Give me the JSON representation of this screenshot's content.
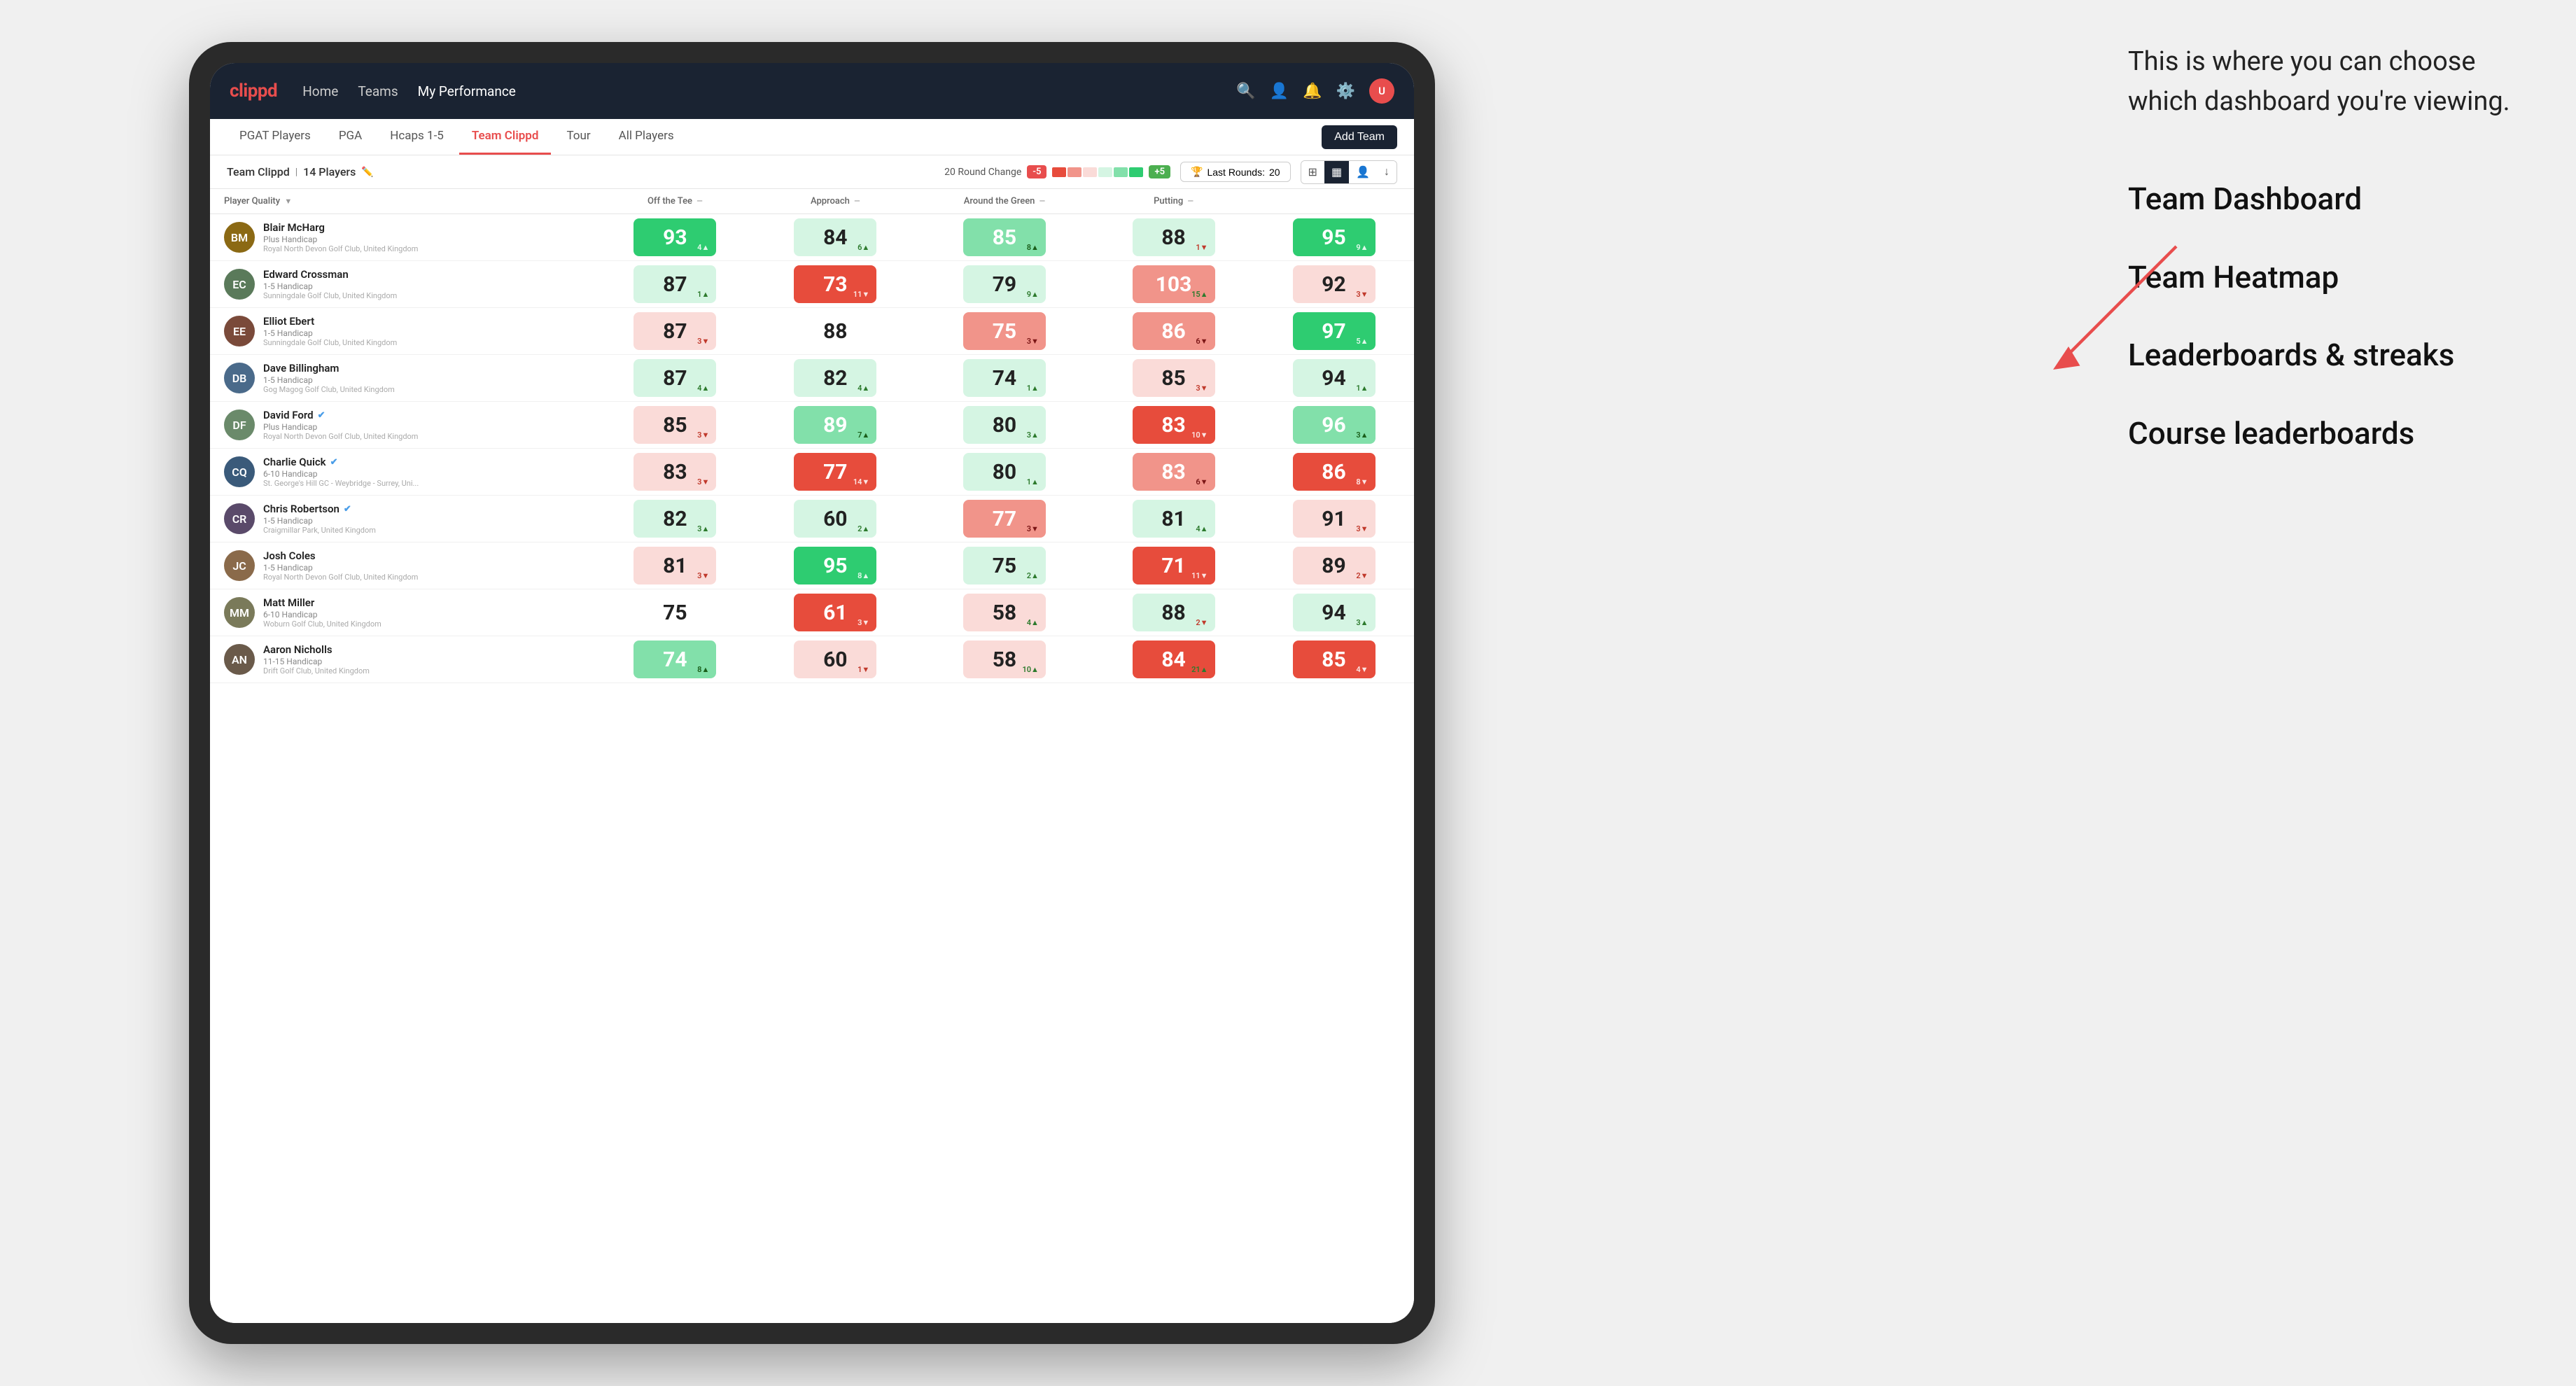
{
  "annotation": {
    "intro": "This is where you can choose which dashboard you're viewing.",
    "items": [
      "Team Dashboard",
      "Team Heatmap",
      "Leaderboards & streaks",
      "Course leaderboards"
    ]
  },
  "navbar": {
    "logo": "clippd",
    "links": [
      {
        "label": "Home",
        "active": false
      },
      {
        "label": "Teams",
        "active": false
      },
      {
        "label": "My Performance",
        "active": true
      }
    ],
    "icons": [
      "search",
      "person",
      "bell",
      "settings",
      "avatar"
    ]
  },
  "sub_nav": {
    "tabs": [
      {
        "label": "PGAT Players",
        "active": false
      },
      {
        "label": "PGA",
        "active": false
      },
      {
        "label": "Hcaps 1-5",
        "active": false
      },
      {
        "label": "Team Clippd",
        "active": true
      },
      {
        "label": "Tour",
        "active": false
      },
      {
        "label": "All Players",
        "active": false
      }
    ],
    "add_team_label": "Add Team"
  },
  "team_header": {
    "title": "Team Clippd",
    "count": "14 Players",
    "round_change_label": "20 Round Change",
    "round_neg": "-5",
    "round_pos": "+5",
    "last_rounds_label": "Last Rounds:",
    "last_rounds_value": "20"
  },
  "table": {
    "columns": [
      {
        "label": "Player Quality",
        "sort": "▼",
        "key": "player_quality"
      },
      {
        "label": "Off the Tee",
        "sort": "—",
        "key": "off_tee"
      },
      {
        "label": "Approach",
        "sort": "—",
        "key": "approach"
      },
      {
        "label": "Around the Green",
        "sort": "—",
        "key": "around_green"
      },
      {
        "label": "Putting",
        "sort": "—",
        "key": "putting"
      }
    ],
    "rows": [
      {
        "name": "Blair McHarg",
        "handicap": "Plus Handicap",
        "club": "Royal North Devon Golf Club, United Kingdom",
        "initials": "BM",
        "avatar_color": "#8B6914",
        "scores": [
          {
            "value": "93",
            "change": "4▲",
            "direction": "up",
            "bg": "bg-green-strong"
          },
          {
            "value": "84",
            "change": "6▲",
            "direction": "up",
            "bg": "bg-green-light"
          },
          {
            "value": "85",
            "change": "8▲",
            "direction": "up",
            "bg": "bg-green-med"
          },
          {
            "value": "88",
            "change": "1▼",
            "direction": "down",
            "bg": "bg-green-light"
          },
          {
            "value": "95",
            "change": "9▲",
            "direction": "up",
            "bg": "bg-green-strong"
          }
        ]
      },
      {
        "name": "Edward Crossman",
        "handicap": "1-5 Handicap",
        "club": "Sunningdale Golf Club, United Kingdom",
        "initials": "EC",
        "avatar_color": "#5a7a5a",
        "scores": [
          {
            "value": "87",
            "change": "1▲",
            "direction": "up",
            "bg": "bg-green-light"
          },
          {
            "value": "73",
            "change": "11▼",
            "direction": "down",
            "bg": "bg-red-strong"
          },
          {
            "value": "79",
            "change": "9▲",
            "direction": "up",
            "bg": "bg-green-light"
          },
          {
            "value": "103",
            "change": "15▲",
            "direction": "up",
            "bg": "bg-red-med"
          },
          {
            "value": "92",
            "change": "3▼",
            "direction": "down",
            "bg": "bg-red-light"
          }
        ]
      },
      {
        "name": "Elliot Ebert",
        "handicap": "1-5 Handicap",
        "club": "Sunningdale Golf Club, United Kingdom",
        "initials": "EE",
        "avatar_color": "#7a4a3a",
        "scores": [
          {
            "value": "87",
            "change": "3▼",
            "direction": "down",
            "bg": "bg-red-light"
          },
          {
            "value": "88",
            "change": "",
            "direction": "neutral",
            "bg": "bg-white"
          },
          {
            "value": "75",
            "change": "3▼",
            "direction": "down",
            "bg": "bg-red-med"
          },
          {
            "value": "86",
            "change": "6▼",
            "direction": "down",
            "bg": "bg-red-med"
          },
          {
            "value": "97",
            "change": "5▲",
            "direction": "up",
            "bg": "bg-green-strong"
          }
        ]
      },
      {
        "name": "Dave Billingham",
        "handicap": "1-5 Handicap",
        "club": "Gog Magog Golf Club, United Kingdom",
        "initials": "DB",
        "avatar_color": "#4a6a8a",
        "scores": [
          {
            "value": "87",
            "change": "4▲",
            "direction": "up",
            "bg": "bg-green-light"
          },
          {
            "value": "82",
            "change": "4▲",
            "direction": "up",
            "bg": "bg-green-light"
          },
          {
            "value": "74",
            "change": "1▲",
            "direction": "up",
            "bg": "bg-green-light"
          },
          {
            "value": "85",
            "change": "3▼",
            "direction": "down",
            "bg": "bg-red-light"
          },
          {
            "value": "94",
            "change": "1▲",
            "direction": "up",
            "bg": "bg-green-light"
          }
        ]
      },
      {
        "name": "David Ford",
        "handicap": "Plus Handicap",
        "club": "Royal North Devon Golf Club, United Kingdom",
        "initials": "DF",
        "avatar_color": "#6a8a6a",
        "verified": true,
        "scores": [
          {
            "value": "85",
            "change": "3▼",
            "direction": "down",
            "bg": "bg-red-light"
          },
          {
            "value": "89",
            "change": "7▲",
            "direction": "up",
            "bg": "bg-green-med"
          },
          {
            "value": "80",
            "change": "3▲",
            "direction": "up",
            "bg": "bg-green-light"
          },
          {
            "value": "83",
            "change": "10▼",
            "direction": "down",
            "bg": "bg-red-strong"
          },
          {
            "value": "96",
            "change": "3▲",
            "direction": "up",
            "bg": "bg-green-med"
          }
        ]
      },
      {
        "name": "Charlie Quick",
        "handicap": "6-10 Handicap",
        "club": "St. George's Hill GC - Weybridge - Surrey, Uni...",
        "initials": "CQ",
        "avatar_color": "#3a5a7a",
        "verified": true,
        "scores": [
          {
            "value": "83",
            "change": "3▼",
            "direction": "down",
            "bg": "bg-red-light"
          },
          {
            "value": "77",
            "change": "14▼",
            "direction": "down",
            "bg": "bg-red-strong"
          },
          {
            "value": "80",
            "change": "1▲",
            "direction": "up",
            "bg": "bg-green-light"
          },
          {
            "value": "83",
            "change": "6▼",
            "direction": "down",
            "bg": "bg-red-med"
          },
          {
            "value": "86",
            "change": "8▼",
            "direction": "down",
            "bg": "bg-red-strong"
          }
        ]
      },
      {
        "name": "Chris Robertson",
        "handicap": "1-5 Handicap",
        "club": "Craigmillar Park, United Kingdom",
        "initials": "CR",
        "avatar_color": "#5a4a6a",
        "verified": true,
        "scores": [
          {
            "value": "82",
            "change": "3▲",
            "direction": "up",
            "bg": "bg-green-light"
          },
          {
            "value": "60",
            "change": "2▲",
            "direction": "up",
            "bg": "bg-green-light"
          },
          {
            "value": "77",
            "change": "3▼",
            "direction": "down",
            "bg": "bg-red-med"
          },
          {
            "value": "81",
            "change": "4▲",
            "direction": "up",
            "bg": "bg-green-light"
          },
          {
            "value": "91",
            "change": "3▼",
            "direction": "down",
            "bg": "bg-red-light"
          }
        ]
      },
      {
        "name": "Josh Coles",
        "handicap": "1-5 Handicap",
        "club": "Royal North Devon Golf Club, United Kingdom",
        "initials": "JC",
        "avatar_color": "#8a6a4a",
        "scores": [
          {
            "value": "81",
            "change": "3▼",
            "direction": "down",
            "bg": "bg-red-light"
          },
          {
            "value": "95",
            "change": "8▲",
            "direction": "up",
            "bg": "bg-green-strong"
          },
          {
            "value": "75",
            "change": "2▲",
            "direction": "up",
            "bg": "bg-green-light"
          },
          {
            "value": "71",
            "change": "11▼",
            "direction": "down",
            "bg": "bg-red-strong"
          },
          {
            "value": "89",
            "change": "2▼",
            "direction": "down",
            "bg": "bg-red-light"
          }
        ]
      },
      {
        "name": "Matt Miller",
        "handicap": "6-10 Handicap",
        "club": "Woburn Golf Club, United Kingdom",
        "initials": "MM",
        "avatar_color": "#7a7a5a",
        "scores": [
          {
            "value": "75",
            "change": "",
            "direction": "neutral",
            "bg": "bg-white"
          },
          {
            "value": "61",
            "change": "3▼",
            "direction": "down",
            "bg": "bg-red-strong"
          },
          {
            "value": "58",
            "change": "4▲",
            "direction": "up",
            "bg": "bg-red-light"
          },
          {
            "value": "88",
            "change": "2▼",
            "direction": "down",
            "bg": "bg-green-light"
          },
          {
            "value": "94",
            "change": "3▲",
            "direction": "up",
            "bg": "bg-green-light"
          }
        ]
      },
      {
        "name": "Aaron Nicholls",
        "handicap": "11-15 Handicap",
        "club": "Drift Golf Club, United Kingdom",
        "initials": "AN",
        "avatar_color": "#6a5a4a",
        "scores": [
          {
            "value": "74",
            "change": "8▲",
            "direction": "up",
            "bg": "bg-green-med"
          },
          {
            "value": "60",
            "change": "1▼",
            "direction": "down",
            "bg": "bg-red-light"
          },
          {
            "value": "58",
            "change": "10▲",
            "direction": "up",
            "bg": "bg-red-light"
          },
          {
            "value": "84",
            "change": "21▲",
            "direction": "up",
            "bg": "bg-red-strong"
          },
          {
            "value": "85",
            "change": "4▼",
            "direction": "down",
            "bg": "bg-red-strong"
          }
        ]
      }
    ]
  }
}
